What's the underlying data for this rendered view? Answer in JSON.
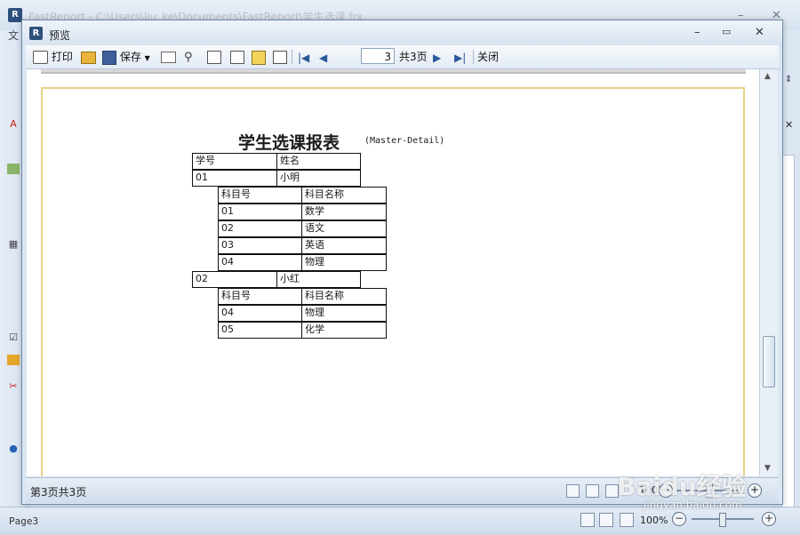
{
  "background_window": {
    "title": "FastReport - C:\\Users\\liu_ke\\Documents\\FastReport\\学生选课.frx",
    "menu_first": "文",
    "status_text": "Page3",
    "zoom": "100%"
  },
  "preview": {
    "title": "预览",
    "toolbar": {
      "print_label": "打印",
      "save_label": "保存",
      "page_number": "3",
      "total_pages": "共3页",
      "close_label": "关闭"
    },
    "status_text": "第3页共3页",
    "zoom": "100%"
  },
  "report": {
    "title": "学生选课报表",
    "subtitle": "(Master-Detail)",
    "master_headers": [
      "学号",
      "姓名"
    ],
    "detail_headers": [
      "科目号",
      "科目名称"
    ],
    "students": [
      {
        "id": "01",
        "name": "小明",
        "courses": [
          [
            "01",
            "数学"
          ],
          [
            "02",
            "语文"
          ],
          [
            "03",
            "英语"
          ],
          [
            "04",
            "物理"
          ]
        ]
      },
      {
        "id": "02",
        "name": "小红",
        "courses": [
          [
            "04",
            "物理"
          ],
          [
            "05",
            "化学"
          ]
        ]
      }
    ]
  },
  "watermark": {
    "brand": "Baidu经验",
    "url": "jingyan.baidu.com"
  }
}
